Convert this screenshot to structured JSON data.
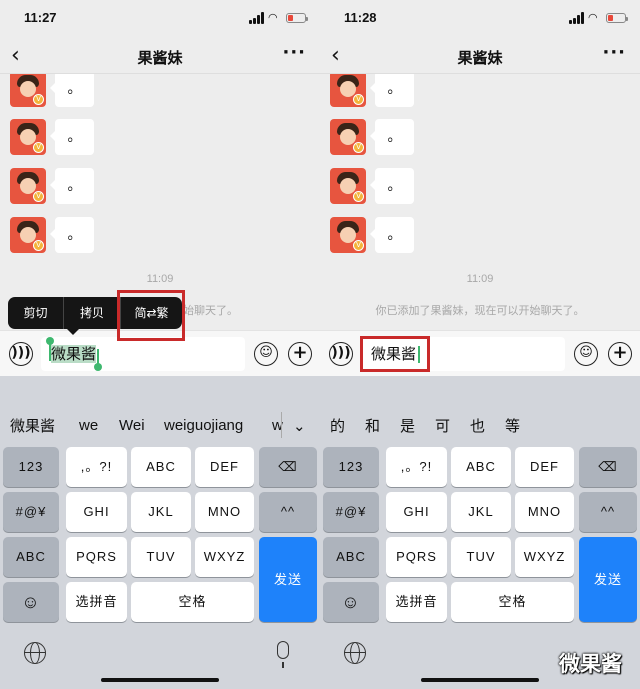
{
  "left": {
    "status_time": "11:27",
    "title": "果酱妹",
    "message_text": "。",
    "chat_time": "11:09",
    "system_message": "你已添加了果酱妹，现在可以开始聊天了。",
    "system_message_visible": "可以开始聊天了。",
    "input_text": "微果酱",
    "menu": {
      "cut": "剪切",
      "copy": "拷贝",
      "convert": "简⇄繁"
    },
    "suggestions": [
      "微果酱",
      "we",
      "Wei",
      "weiguojiang",
      "w"
    ]
  },
  "right": {
    "status_time": "11:28",
    "title": "果酱妹",
    "message_text": "。",
    "chat_time": "11:09",
    "system_message": "你已添加了果酱妹，现在可以开始聊天了。",
    "input_text": "微果酱",
    "suggestions": [
      "的",
      "和",
      "是",
      "可",
      "也",
      "等"
    ]
  },
  "keyboard": {
    "row1": [
      "123",
      ",。?!",
      "ABC",
      "DEF",
      "⌫"
    ],
    "row2": [
      "#@¥",
      "GHI",
      "JKL",
      "MNO",
      "^^"
    ],
    "row3": [
      "ABC",
      "PQRS",
      "TUV",
      "WXYZ",
      "发送"
    ],
    "row4": [
      "☺",
      "选拼音",
      "空格"
    ]
  },
  "icons": {
    "back": "chevron-left-icon",
    "more": "more-icon",
    "voice": "voice-icon",
    "emoji": "emoji-icon",
    "plus": "plus-icon",
    "globe": "globe-icon",
    "mic": "microphone-icon"
  },
  "colors": {
    "highlight_box": "#c92a2a",
    "send_key": "#1e82fa",
    "selection": "#3eb86f"
  },
  "watermark": "微果酱"
}
